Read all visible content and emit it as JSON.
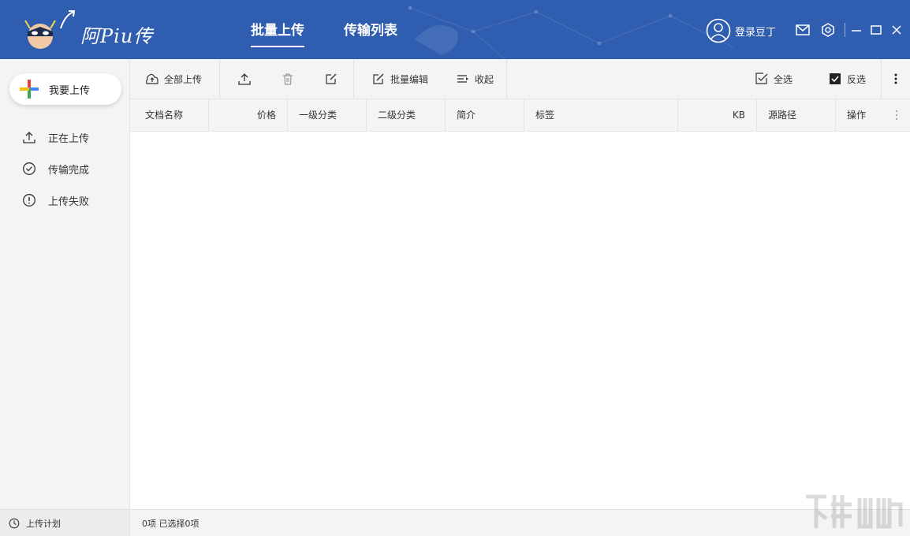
{
  "app": {
    "logo_text": "阿Piu传"
  },
  "header": {
    "tabs": [
      {
        "label": "批量上传",
        "active": true
      },
      {
        "label": "传输列表",
        "active": false
      }
    ],
    "user_label": "登录豆丁",
    "icons": [
      "user-avatar-icon",
      "mail-icon",
      "settings-icon",
      "minimize-icon",
      "maximize-icon",
      "close-icon"
    ],
    "colors": {
      "header_bg": "#2f5db0",
      "sidebar_bg": "#f4f4f4"
    }
  },
  "sidebar": {
    "upload_button": "我要上传",
    "items": [
      {
        "label": "正在上传",
        "icon": "upload-icon"
      },
      {
        "label": "传输完成",
        "icon": "check-circle-icon"
      },
      {
        "label": "上传失败",
        "icon": "alert-circle-icon"
      }
    ],
    "footer_label": "上传计划"
  },
  "toolbar": {
    "upload_all": "全部上传",
    "batch_edit": "批量编辑",
    "collapse": "收起",
    "select_all": "全选",
    "invert_select": "反选"
  },
  "table": {
    "columns": [
      "文档名称",
      "价格",
      "一级分类",
      "二级分类",
      "简介",
      "标签",
      "KB",
      "源路径",
      "操作"
    ],
    "rows": []
  },
  "status": {
    "summary": "0项 已选择0项"
  }
}
